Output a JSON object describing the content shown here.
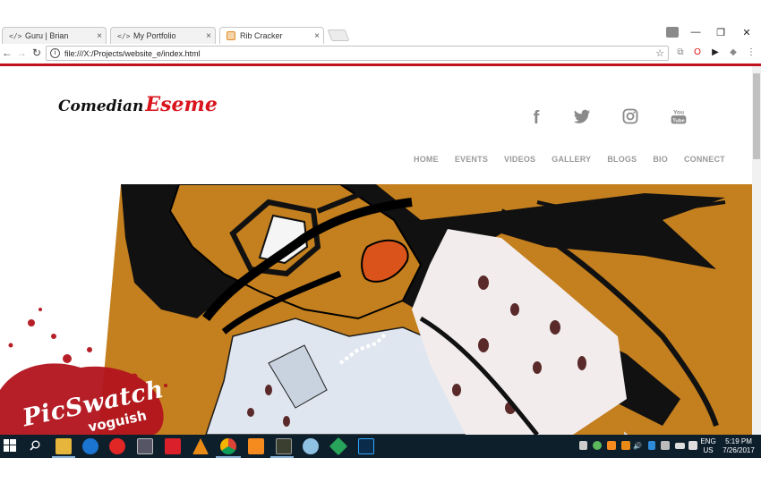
{
  "browser": {
    "tabs": [
      {
        "icon": "code-icon",
        "label": "Guru | Brian"
      },
      {
        "icon": "code-icon",
        "label": "My Portfolio"
      },
      {
        "icon": "ribcracker-favicon",
        "label": "Rib Cracker"
      }
    ],
    "icon_glyphs": {
      "code": "</>",
      "close": "×"
    },
    "url": "file:///X:/Projects/website_e/index.html",
    "accent_color": "#c1121f"
  },
  "site": {
    "logo_prefix": "Comedian",
    "logo_name": "Eseme",
    "social": [
      "facebook",
      "twitter",
      "instagram",
      "youtube"
    ],
    "social_glyphs": {
      "facebook": "f",
      "youtube_top": "You",
      "youtube_bottom": "Tube"
    },
    "nav": [
      "HOME",
      "EVENTS",
      "VIDEOS",
      "GALLERY",
      "BLOGS",
      "BIO",
      "CONNECT"
    ],
    "hero": {
      "watermark_title": "PicSwatch",
      "watermark_sub": "voguish",
      "next_glyph": "›"
    }
  },
  "taskbar": {
    "lang": "ENG",
    "region": "US",
    "time": "5:19 PM",
    "date": "7/26/2017"
  }
}
